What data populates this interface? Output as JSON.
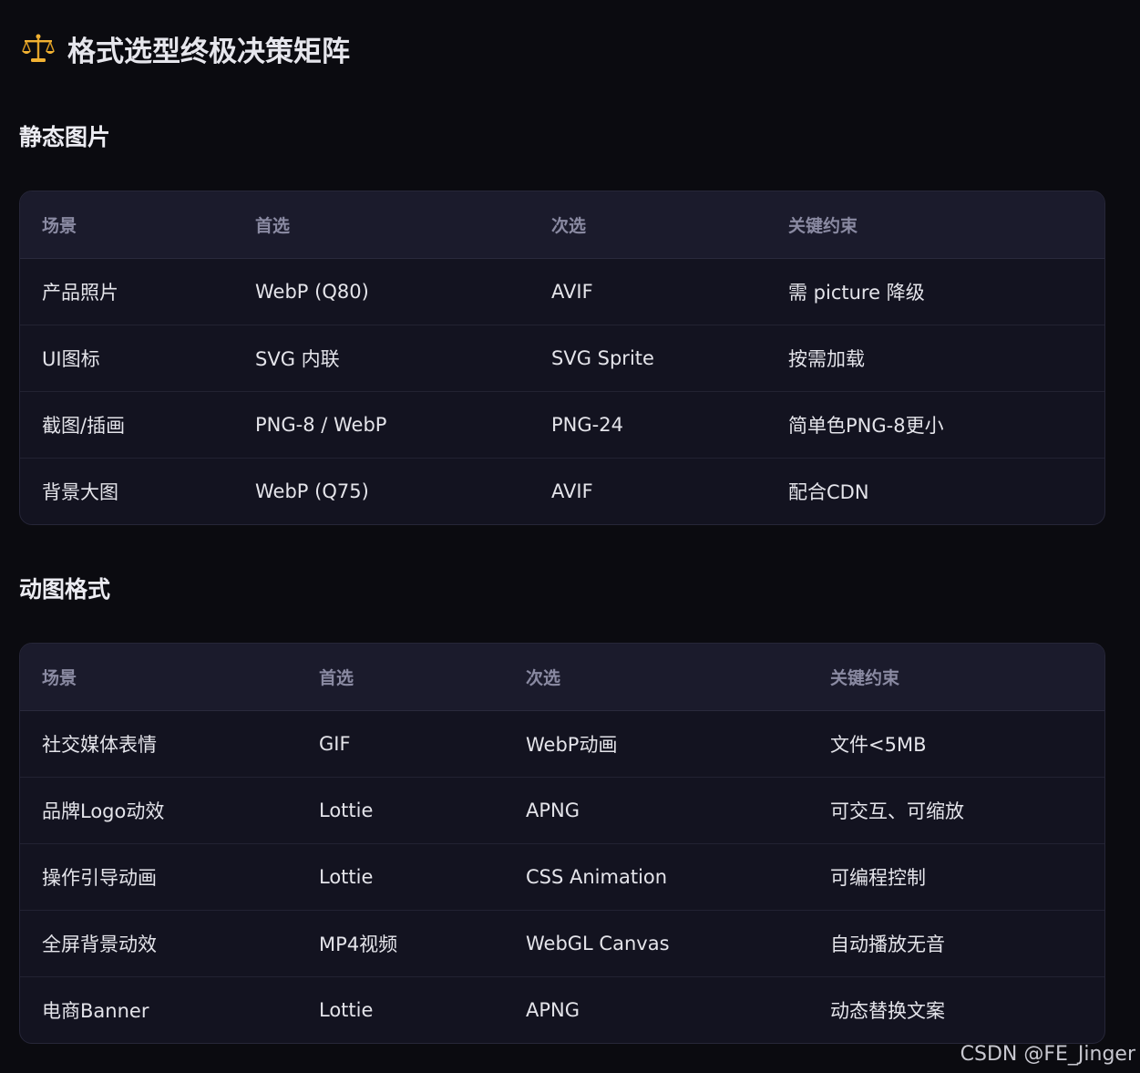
{
  "page": {
    "title": "格式选型终极决策矩阵",
    "title_icon": "balance-scale-icon"
  },
  "static_section": {
    "title": "静态图片",
    "headers": [
      "场景",
      "首选",
      "次选",
      "关键约束"
    ],
    "rows": [
      [
        "产品照片",
        "WebP (Q80)",
        "AVIF",
        "需 picture 降级"
      ],
      [
        "UI图标",
        "SVG 内联",
        "SVG Sprite",
        "按需加载"
      ],
      [
        "截图/插画",
        "PNG-8 / WebP",
        "PNG-24",
        "简单色PNG-8更小"
      ],
      [
        "背景大图",
        "WebP (Q75)",
        "AVIF",
        "配合CDN"
      ]
    ]
  },
  "animated_section": {
    "title": "动图格式",
    "headers": [
      "场景",
      "首选",
      "次选",
      "关键约束"
    ],
    "rows": [
      [
        "社交媒体表情",
        "GIF",
        "WebP动画",
        "文件<5MB"
      ],
      [
        "品牌Logo动效",
        "Lottie",
        "APNG",
        "可交互、可缩放"
      ],
      [
        "操作引导动画",
        "Lottie",
        "CSS Animation",
        "可编程控制"
      ],
      [
        "全屏背景动效",
        "MP4视频",
        "WebGL Canvas",
        "自动播放无音"
      ],
      [
        "电商Banner",
        "Lottie",
        "APNG",
        "动态替换文案"
      ]
    ]
  },
  "watermark": "CSDN @FE_Jinger",
  "colors": {
    "background": "#0b0b10",
    "table_bg": "#131320",
    "header_bg": "#1b1b2c",
    "header_text": "#8a8aa2",
    "icon_gold": "#f2b233"
  }
}
